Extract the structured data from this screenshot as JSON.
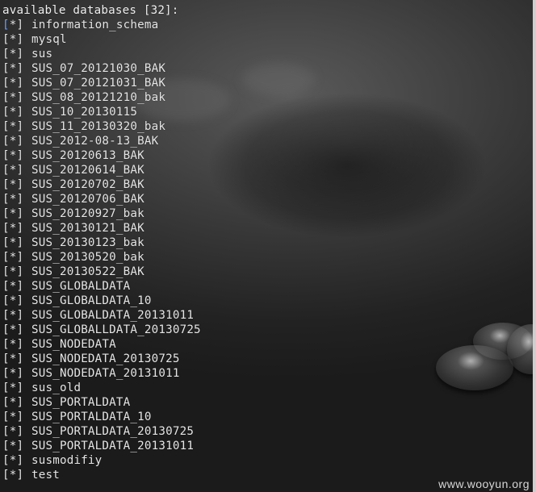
{
  "terminal": {
    "header": "available databases [32]:",
    "marker": "[*]",
    "databases": [
      "information_schema",
      "mysql",
      "sus",
      "SUS_07_20121030_BAK",
      "SUS_07_20121031_BAK",
      "SUS_08_20121210_bak",
      "SUS_10_20130115",
      "SUS_11_20130320_bak",
      "SUS_2012-08-13_BAK",
      "SUS_20120613_BAK",
      "SUS_20120614_BAK",
      "SUS_20120702_BAK",
      "SUS_20120706_BAK",
      "SUS_20120927_bak",
      "SUS_20130121_BAK",
      "SUS_20130123_bak",
      "SUS_20130520_bak",
      "SUS_20130522_BAK",
      "SUS_GLOBALDATA",
      "SUS_GLOBALDATA_10",
      "SUS_GLOBALDATA_20131011",
      "SUS_GLOBALLDATA_20130725",
      "SUS_NODEDATA",
      "SUS_NODEDATA_20130725",
      "SUS_NODEDATA_20131011",
      "sus_old",
      "SUS_PORTALDATA",
      "SUS_PORTALDATA_10",
      "SUS_PORTALDATA_20130725",
      "SUS_PORTALDATA_20131011",
      "susmodifiy",
      "test"
    ]
  },
  "watermark": "www.wooyun.org",
  "colors": {
    "text": "#e6e6e6",
    "background": "#2a2a2a",
    "first_bracket": "#6fa2ff"
  }
}
